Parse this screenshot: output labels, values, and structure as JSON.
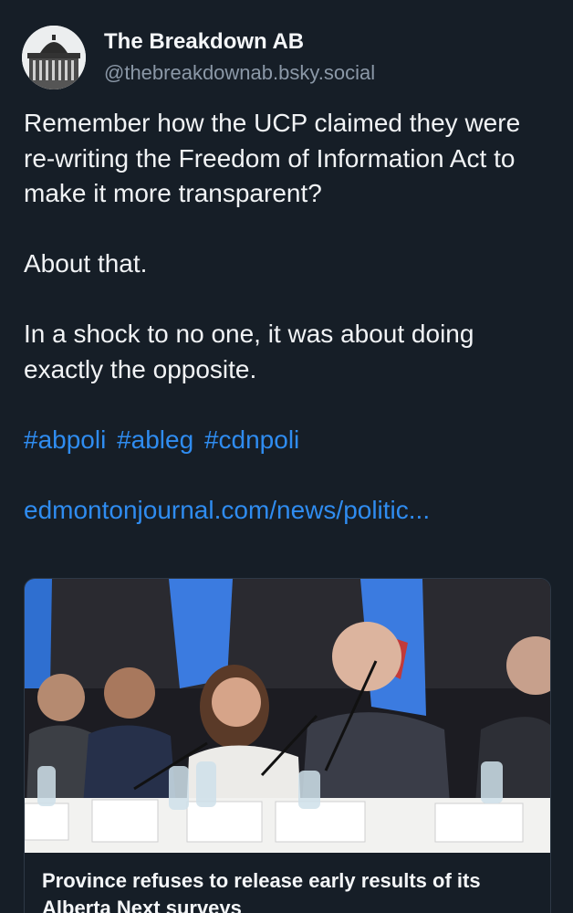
{
  "author": {
    "display_name": "The Breakdown AB",
    "handle": "@thebreakdownab.bsky.social",
    "avatar_icon": "legislature-building-avatar"
  },
  "post": {
    "paragraph_1": "Remember how the UCP claimed they were re-writing the Freedom of Information Act to make it more transparent?",
    "paragraph_2": "About that.",
    "paragraph_3": "In a shock to no one, it was about doing exactly the opposite.",
    "hashtags": [
      "#abpoli",
      "#ableg",
      "#cdnpoli"
    ],
    "link_text": "edmontonjournal.com/news/politic..."
  },
  "link_card": {
    "image_icon": "press-conference-photo",
    "title": "Province refuses to release early results of its Alberta Next surveys"
  },
  "colors": {
    "background": "#161e27",
    "link": "#2f8cf0",
    "handle": "#8b98a7",
    "text": "#f1f3f5"
  }
}
